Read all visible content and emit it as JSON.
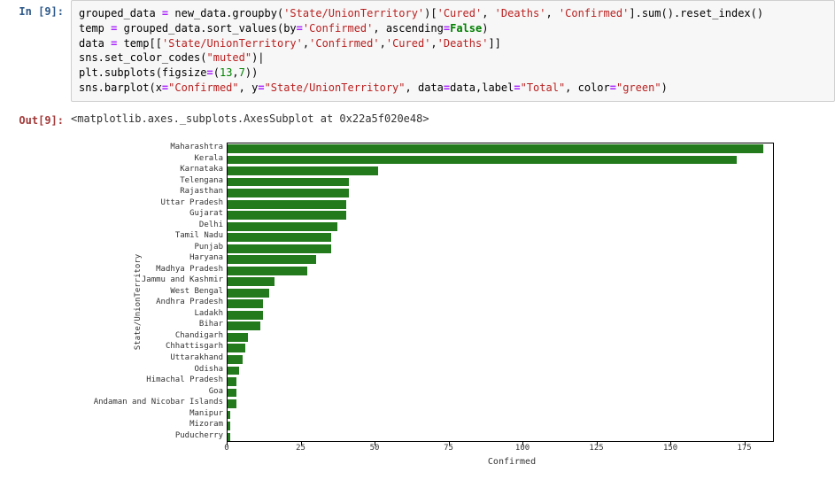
{
  "in_prompt": "In [9]:",
  "out_prompt": "Out[9]:",
  "code_lines": [
    [
      {
        "t": "grouped_data ",
        "c": "k-var"
      },
      {
        "t": "=",
        "c": "k-op"
      },
      {
        "t": " new_data.groupby(",
        "c": "k-var"
      },
      {
        "t": "'State/UnionTerritory'",
        "c": "k-str"
      },
      {
        "t": ")[",
        "c": "k-var"
      },
      {
        "t": "'Cured'",
        "c": "k-str"
      },
      {
        "t": ", ",
        "c": "k-var"
      },
      {
        "t": "'Deaths'",
        "c": "k-str"
      },
      {
        "t": ", ",
        "c": "k-var"
      },
      {
        "t": "'Confirmed'",
        "c": "k-str"
      },
      {
        "t": "].sum().reset_index()",
        "c": "k-var"
      }
    ],
    [
      {
        "t": "temp ",
        "c": "k-var"
      },
      {
        "t": "=",
        "c": "k-op"
      },
      {
        "t": " grouped_data.sort_values(by",
        "c": "k-var"
      },
      {
        "t": "=",
        "c": "k-op"
      },
      {
        "t": "'Confirmed'",
        "c": "k-str"
      },
      {
        "t": ", ascending",
        "c": "k-var"
      },
      {
        "t": "=",
        "c": "k-op"
      },
      {
        "t": "False",
        "c": "k-kw"
      },
      {
        "t": ")",
        "c": "k-var"
      }
    ],
    [
      {
        "t": "data ",
        "c": "k-var"
      },
      {
        "t": "=",
        "c": "k-op"
      },
      {
        "t": " temp[[",
        "c": "k-var"
      },
      {
        "t": "'State/UnionTerritory'",
        "c": "k-str"
      },
      {
        "t": ",",
        "c": "k-var"
      },
      {
        "t": "'Confirmed'",
        "c": "k-str"
      },
      {
        "t": ",",
        "c": "k-var"
      },
      {
        "t": "'Cured'",
        "c": "k-str"
      },
      {
        "t": ",",
        "c": "k-var"
      },
      {
        "t": "'Deaths'",
        "c": "k-str"
      },
      {
        "t": "]]",
        "c": "k-var"
      }
    ],
    [
      {
        "t": "sns.set_color_codes(",
        "c": "k-var"
      },
      {
        "t": "\"muted\"",
        "c": "k-str"
      },
      {
        "t": ")|",
        "c": "k-var"
      }
    ],
    [
      {
        "t": "plt.subplots(figsize",
        "c": "k-var"
      },
      {
        "t": "=",
        "c": "k-op"
      },
      {
        "t": "(",
        "c": "k-var"
      },
      {
        "t": "13",
        "c": "k-num"
      },
      {
        "t": ",",
        "c": "k-var"
      },
      {
        "t": "7",
        "c": "k-num"
      },
      {
        "t": "))",
        "c": "k-var"
      }
    ],
    [
      {
        "t": "sns.barplot(x",
        "c": "k-var"
      },
      {
        "t": "=",
        "c": "k-op"
      },
      {
        "t": "\"Confirmed\"",
        "c": "k-str"
      },
      {
        "t": ", y",
        "c": "k-var"
      },
      {
        "t": "=",
        "c": "k-op"
      },
      {
        "t": "\"State/UnionTerritory\"",
        "c": "k-str"
      },
      {
        "t": ", data",
        "c": "k-var"
      },
      {
        "t": "=",
        "c": "k-op"
      },
      {
        "t": "data,label",
        "c": "k-var"
      },
      {
        "t": "=",
        "c": "k-op"
      },
      {
        "t": "\"Total\"",
        "c": "k-str"
      },
      {
        "t": ", color",
        "c": "k-var"
      },
      {
        "t": "=",
        "c": "k-op"
      },
      {
        "t": "\"green\"",
        "c": "k-str"
      },
      {
        "t": ")",
        "c": "k-var"
      }
    ]
  ],
  "out_text": "<matplotlib.axes._subplots.AxesSubplot at 0x22a5f020e48>",
  "chart_data": {
    "type": "bar",
    "orientation": "horizontal",
    "xlabel": "Confirmed",
    "ylabel": "State/UnionTerritory",
    "xlim": [
      0,
      185
    ],
    "xticks": [
      0,
      25,
      50,
      75,
      100,
      125,
      150,
      175
    ],
    "bar_color": "#227a1c",
    "categories": [
      "Maharashtra",
      "Kerala",
      "Karnataka",
      "Telengana",
      "Rajasthan",
      "Uttar Pradesh",
      "Gujarat",
      "Delhi",
      "Tamil Nadu",
      "Punjab",
      "Haryana",
      "Madhya Pradesh",
      "Jammu and Kashmir",
      "West Bengal",
      "Andhra Pradesh",
      "Ladakh",
      "Bihar",
      "Chandigarh",
      "Chhattisgarh",
      "Uttarakhand",
      "Odisha",
      "Himachal Pradesh",
      "Goa",
      "Andaman and Nicobar Islands",
      "Manipur",
      "Mizoram",
      "Puducherry"
    ],
    "values": [
      181,
      172,
      51,
      41,
      41,
      40,
      40,
      37,
      35,
      35,
      30,
      27,
      16,
      14,
      12,
      12,
      11,
      7,
      6,
      5,
      4,
      3,
      3,
      3,
      1,
      1,
      1
    ]
  }
}
